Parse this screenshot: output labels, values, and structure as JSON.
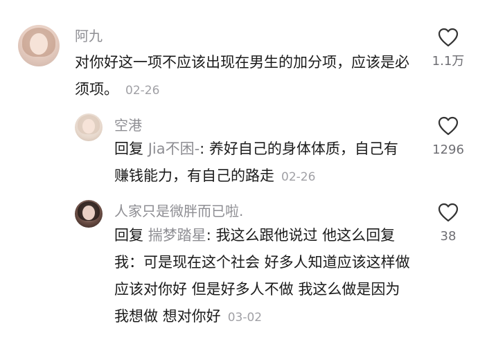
{
  "comments": [
    {
      "author": "阿九",
      "text": "对你好这一项不应该出现在男生的加分项，应该是必须项。",
      "date": "02-26",
      "likes": "1.1万"
    },
    {
      "author": "空港",
      "reply_prefix": "回复",
      "reply_to": "Jia不困-",
      "text": ": 养好自己的身体体质，自己有赚钱能力，有自己的路走",
      "date": "02-26",
      "likes": "1296"
    },
    {
      "author": "人家只是微胖而已啦.",
      "reply_prefix": "回复",
      "reply_to": "揣梦踏星",
      "text": ": 我这么跟他说过 他这么回复我：可是现在这个社会 好多人知道应该这样做 应该对你好 但是好多人不做 我这么做是因为我想做 想对你好",
      "date": "03-02",
      "likes": "38"
    }
  ],
  "icons": {
    "like": "heart-outline-icon"
  },
  "colors": {
    "name": "#8e8e93",
    "text": "#1a1a1a",
    "date": "#a0a0a5"
  }
}
